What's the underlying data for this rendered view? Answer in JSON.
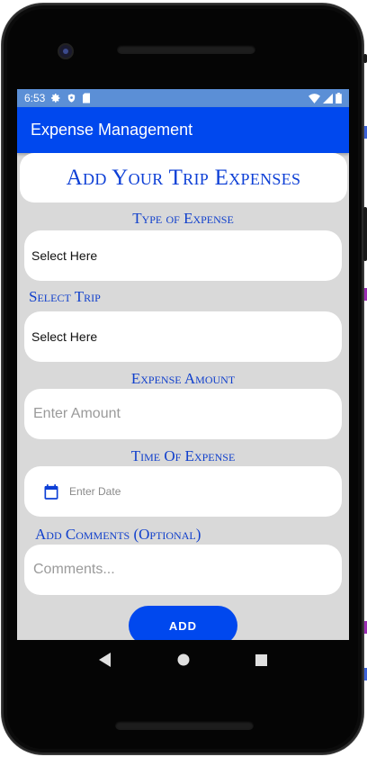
{
  "status_bar": {
    "time": "6:53",
    "icons_left": [
      "gear-icon",
      "shield-icon",
      "sdcard-icon"
    ],
    "icons_right": [
      "wifi-icon",
      "signal-icon",
      "battery-icon"
    ]
  },
  "app_bar": {
    "title": "Expense Management"
  },
  "form": {
    "heading": "Add Your Trip Expenses",
    "type_label": "Type of Expense",
    "type_value": "Select Here",
    "trip_label": "Select Trip",
    "trip_value": "Select Here",
    "amount_label": "Expense Amount",
    "amount_placeholder": "Enter Amount",
    "time_label": "Time Of Expense",
    "date_placeholder": "Enter Date",
    "comments_label": "Add Comments (Optional)",
    "comments_placeholder": "Comments...",
    "add_button": "ADD"
  },
  "nav_bar": {
    "buttons": [
      "back-icon",
      "home-icon",
      "recents-icon"
    ]
  },
  "colors": {
    "primary": "#0048ee",
    "status_bar": "#5b8fd6",
    "label_text": "#1140cc",
    "screen_background": "#d9d9d9"
  }
}
